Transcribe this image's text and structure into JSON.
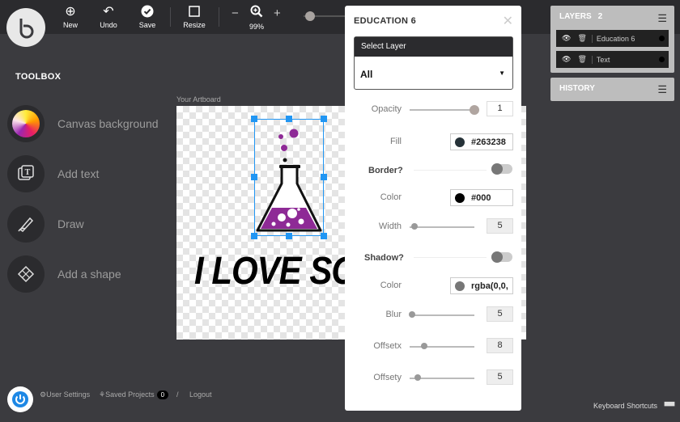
{
  "toolbar": {
    "new_label": "New",
    "undo_label": "Undo",
    "save_label": "Save",
    "resize_label": "Resize",
    "zoom_level": "99%"
  },
  "toolbox": {
    "title": "TOOLBOX",
    "items": [
      {
        "label": "Canvas background",
        "icon": "color-wheel-icon"
      },
      {
        "label": "Add text",
        "icon": "text-icon"
      },
      {
        "label": "Draw",
        "icon": "pen-icon"
      },
      {
        "label": "Add a shape",
        "icon": "shape-icon"
      }
    ]
  },
  "artboard": {
    "label": "Your Artboard",
    "text": "I LOVE SCIENCE",
    "flask_color": "#8e2a96"
  },
  "properties": {
    "title": "EDUCATION 6",
    "select_layer_label": "Select Layer",
    "select_layer_value": "All",
    "opacity_label": "Opacity",
    "opacity_value": "1",
    "opacity_fraction": 1,
    "fill_label": "Fill",
    "fill_value": "#263238",
    "border_label": "Border?",
    "border_enabled": false,
    "border_color_label": "Color",
    "border_color_value": "#000",
    "border_width_label": "Width",
    "border_width_value": "5",
    "shadow_label": "Shadow?",
    "shadow_enabled": false,
    "shadow_color_label": "Color",
    "shadow_color_value": "rgba(0,0,",
    "blur_label": "Blur",
    "blur_value": "5",
    "offsetx_label": "Offsetx",
    "offsetx_value": "8",
    "offsety_label": "Offsety",
    "offsety_value": "5"
  },
  "layers": {
    "title": "LAYERS",
    "count": "2",
    "items": [
      {
        "label": "Education 6"
      },
      {
        "label": "Text"
      }
    ]
  },
  "history": {
    "title": "HISTORY"
  },
  "footer": {
    "user_settings": "User Settings",
    "saved_projects": "Saved Projects",
    "saved_count": "0",
    "separator": "/",
    "logout": "Logout",
    "keyboard_shortcuts": "Keyboard Shortcuts"
  }
}
